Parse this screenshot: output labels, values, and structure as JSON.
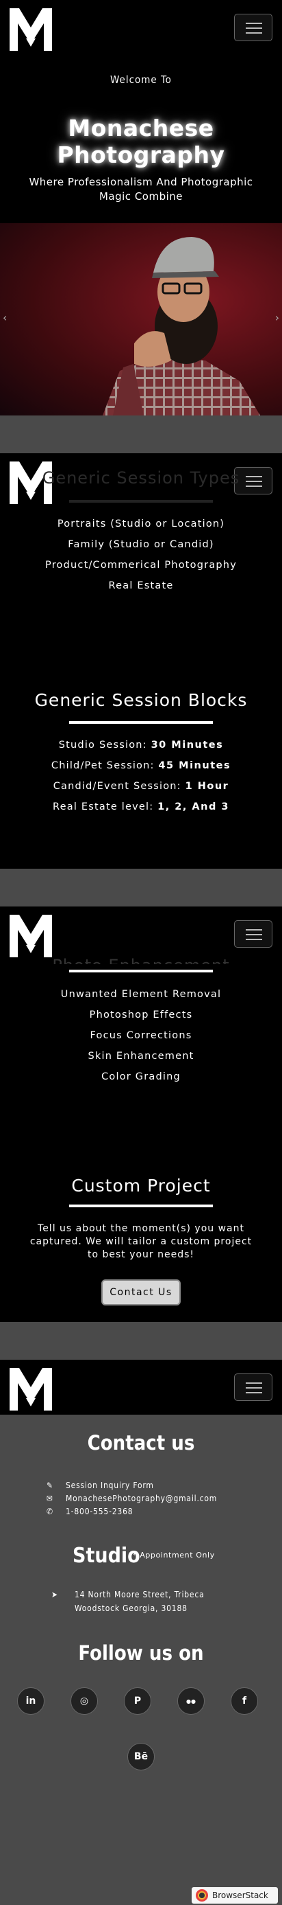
{
  "nav": {
    "logo_alt": "Monachese Photography logo",
    "menu_icon": "hamburger-menu-icon"
  },
  "hero": {
    "welcome": "Welcome To",
    "brand": "Monachese Photography",
    "tagline": "Where Professionalism And Photographic Magic Combine"
  },
  "carousel": {
    "prev_icon": "chevron-left-icon",
    "next_icon": "chevron-right-icon",
    "prev": "‹",
    "next": "›"
  },
  "session_types": {
    "title": "Generic Session Types",
    "items": [
      "Portraits (Studio or Location)",
      "Family (Studio or Candid)",
      "Product/Commerical Photography",
      "Real Estate"
    ]
  },
  "session_blocks": {
    "title": "Generic Session Blocks",
    "items": [
      {
        "label": "Studio Session:",
        "value": "30 Minutes"
      },
      {
        "label": "Child/Pet Session:",
        "value": "45 Minutes"
      },
      {
        "label": "Candid/Event Session:",
        "value": "1 Hour"
      },
      {
        "label": "Real Estate level:",
        "value": "1, 2, And 3"
      }
    ]
  },
  "enhancement": {
    "title": "Photo Enhancement",
    "items": [
      "Unwanted Element Removal",
      "Photoshop Effects",
      "Focus Corrections",
      "Skin Enhancement",
      "Color Grading"
    ]
  },
  "custom": {
    "title": "Custom Project",
    "description": "Tell us about the moment(s) you want captured. We will tailor a custom project to best your needs!",
    "button": "Contact Us"
  },
  "contact": {
    "title": "Contact us",
    "form_label": "Session Inquiry Form",
    "email": "MonachesePhotography@gmail.com",
    "phone": "1-800-555-2368",
    "studio_title": "Studio",
    "studio_note": "* Appointment Only",
    "address_line1": "14 North Moore Street, Tribeca",
    "address_line2": "Woodstock Georgia, 30188",
    "follow_title": "Follow us on",
    "socials": [
      "in",
      "◎",
      "P",
      "●●",
      "f",
      "Bē"
    ]
  },
  "footer": {
    "badge": "BrowserStack"
  }
}
